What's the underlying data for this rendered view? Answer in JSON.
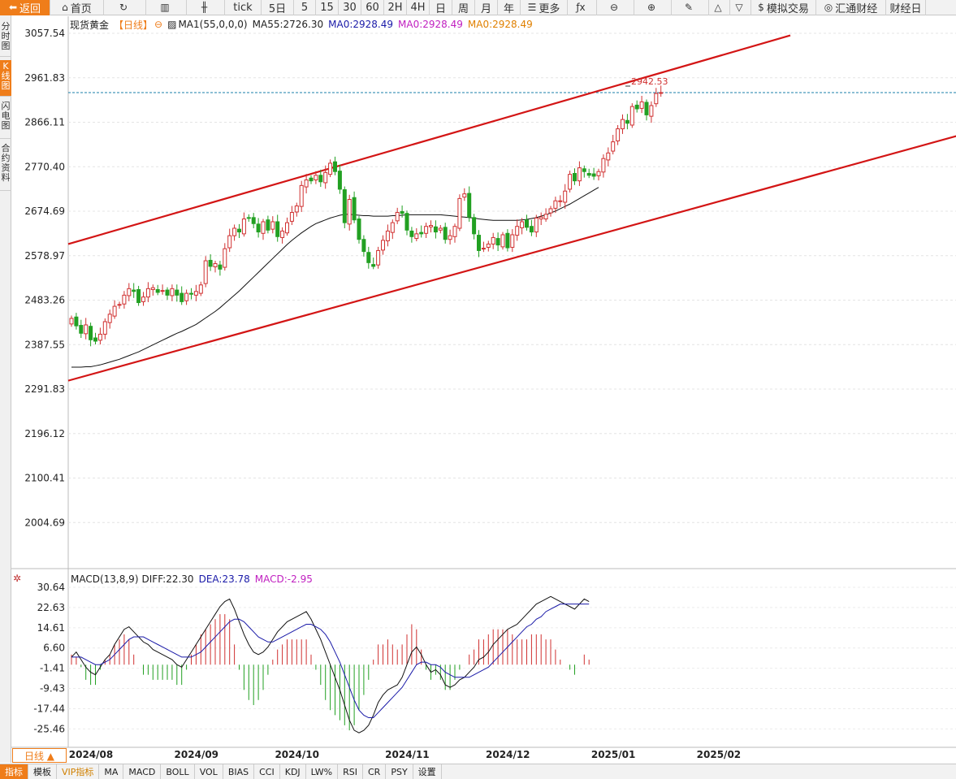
{
  "toolbar": {
    "items": [
      {
        "label": "返回",
        "icon": "back-arrow-icon",
        "glyph": "⬅",
        "w": 62
      },
      {
        "label": "首页",
        "icon": "home-icon",
        "glyph": "⌂",
        "w": 66
      },
      {
        "label": "",
        "icon": "refresh-icon",
        "glyph": "↻",
        "w": 52
      },
      {
        "label": "",
        "icon": "bar-chart-icon",
        "glyph": "▥",
        "w": 50
      },
      {
        "label": "",
        "icon": "candlestick-icon",
        "glyph": "╫",
        "w": 47
      },
      {
        "label": "tick",
        "icon": "",
        "glyph": "",
        "w": 45
      },
      {
        "label": "5日",
        "icon": "",
        "glyph": "",
        "w": 40
      },
      {
        "label": "5",
        "icon": "",
        "glyph": "",
        "w": 27
      },
      {
        "label": "15",
        "icon": "",
        "glyph": "",
        "w": 28
      },
      {
        "label": "30",
        "icon": "",
        "glyph": "",
        "w": 28
      },
      {
        "label": "60",
        "icon": "",
        "glyph": "",
        "w": 28
      },
      {
        "label": "2H",
        "icon": "",
        "glyph": "",
        "w": 28
      },
      {
        "label": "4H",
        "icon": "",
        "glyph": "",
        "w": 28
      },
      {
        "label": "日",
        "icon": "",
        "glyph": "",
        "w": 28
      },
      {
        "label": "周",
        "icon": "",
        "glyph": "",
        "w": 28
      },
      {
        "label": "月",
        "icon": "",
        "glyph": "",
        "w": 28
      },
      {
        "label": "年",
        "icon": "",
        "glyph": "",
        "w": 28
      },
      {
        "label": "更多",
        "icon": "menu-icon",
        "glyph": "☰",
        "w": 58
      },
      {
        "label": "",
        "icon": "formula-icon",
        "glyph": "ƒx",
        "w": 36
      },
      {
        "label": "",
        "icon": "zoom-out-icon",
        "glyph": "⊖",
        "w": 46
      },
      {
        "label": "",
        "icon": "zoom-in-icon",
        "glyph": "⊕",
        "w": 46
      },
      {
        "label": "",
        "icon": "pencil-icon",
        "glyph": "✎",
        "w": 46
      },
      {
        "label": "",
        "icon": "triangle-up-icon",
        "glyph": "△",
        "w": 26
      },
      {
        "label": "",
        "icon": "triangle-down-icon",
        "glyph": "▽",
        "w": 26
      },
      {
        "label": "模拟交易",
        "icon": "dollar-icon",
        "glyph": "$",
        "w": 80
      },
      {
        "label": "汇通财经",
        "icon": "logo-icon",
        "glyph": "◎",
        "w": 86
      },
      {
        "label": "财经日",
        "icon": "",
        "glyph": "",
        "w": 49
      }
    ]
  },
  "side_tabs": [
    {
      "label": "分时图",
      "active": false
    },
    {
      "label": "K线图",
      "active": true
    },
    {
      "label": "闪电图",
      "active": false
    },
    {
      "label": "合约资料",
      "active": false
    }
  ],
  "header": {
    "symbol": "现货黄金",
    "period": "【日线】",
    "ma1": "MA1(55,0,0,0)",
    "ma55": "MA55:2726.30",
    "ma0_a": "MA0:2928.49",
    "ma0_b": "MA0:2928.49",
    "ma0_c": "MA0:2928.49"
  },
  "macd_header": {
    "name": "MACD(13,8,9)",
    "diff": "DIFF:22.30",
    "dea": "DEA:23.78",
    "macd": "MACD:-2.95"
  },
  "date_tag": "日线 ▲",
  "bottom_tabs": [
    {
      "label": "指标",
      "active": true
    },
    {
      "label": "模板"
    },
    {
      "label": "VIP指标",
      "vip": true
    },
    {
      "label": "MA"
    },
    {
      "label": "MACD"
    },
    {
      "label": "BOLL"
    },
    {
      "label": "VOL"
    },
    {
      "label": "BIAS"
    },
    {
      "label": "CCI"
    },
    {
      "label": "KDJ"
    },
    {
      "label": "LW%"
    },
    {
      "label": "RSI"
    },
    {
      "label": "CR"
    },
    {
      "label": "PSY"
    },
    {
      "label": "设置"
    }
  ],
  "colors": {
    "up": "#d03030",
    "down": "#22a022",
    "trend": "#d31515",
    "ma": "#111111",
    "dea": "#1a1aa8",
    "ma0_purple": "#c020c0",
    "ma0_orange": "#e08000",
    "accent": "#ef7d1a"
  },
  "chart_data": [
    {
      "type": "candlestick",
      "title": "现货黄金 日线",
      "y_ticks": [
        3057.54,
        2961.83,
        2866.11,
        2770.4,
        2674.69,
        2578.97,
        2483.26,
        2387.55,
        2291.83,
        2196.12,
        2100.41,
        2004.69
      ],
      "ylim": [
        1960,
        3070
      ],
      "x_tick_labels": [
        "2024/08",
        "2024/09",
        "2024/10",
        "2024/11",
        "2024/12",
        "2025/01",
        "2025/02"
      ],
      "x_tick_index": [
        0,
        22,
        43,
        66,
        87,
        109,
        131
      ],
      "last_price_label": "2942.53",
      "last_price": 2930,
      "closes": [
        2444,
        2428,
        2412,
        2430,
        2398,
        2395,
        2410,
        2437,
        2453,
        2470,
        2474,
        2494,
        2508,
        2502,
        2478,
        2490,
        2508,
        2510,
        2500,
        2504,
        2494,
        2508,
        2494,
        2480,
        2498,
        2496,
        2502,
        2516,
        2568,
        2556,
        2562,
        2550,
        2594,
        2622,
        2638,
        2630,
        2658,
        2660,
        2648,
        2630,
        2652,
        2634,
        2652,
        2620,
        2632,
        2650,
        2672,
        2686,
        2730,
        2742,
        2740,
        2752,
        2738,
        2758,
        2778,
        2760,
        2722,
        2650,
        2700,
        2656,
        2614,
        2588,
        2564,
        2556,
        2590,
        2612,
        2632,
        2650,
        2672,
        2670,
        2634,
        2620,
        2626,
        2626,
        2642,
        2644,
        2630,
        2638,
        2614,
        2622,
        2642,
        2702,
        2712,
        2662,
        2626,
        2590,
        2595,
        2604,
        2618,
        2602,
        2624,
        2596,
        2624,
        2642,
        2652,
        2640,
        2630,
        2660,
        2662,
        2668,
        2680,
        2697,
        2697,
        2718,
        2754,
        2740,
        2768,
        2760,
        2752,
        2750,
        2760,
        2788,
        2800,
        2824,
        2852,
        2872,
        2864,
        2900,
        2895,
        2910,
        2882,
        2902,
        2928,
        2930
      ],
      "ma55": [
        2339,
        2339,
        2339,
        2340,
        2340,
        2342,
        2344,
        2347,
        2350,
        2353,
        2356,
        2360,
        2364,
        2368,
        2372,
        2377,
        2382,
        2387,
        2392,
        2397,
        2402,
        2407,
        2412,
        2416,
        2421,
        2426,
        2431,
        2438,
        2445,
        2452,
        2459,
        2467,
        2476,
        2485,
        2494,
        2503,
        2513,
        2523,
        2533,
        2543,
        2553,
        2563,
        2573,
        2583,
        2593,
        2603,
        2612,
        2620,
        2628,
        2635,
        2642,
        2648,
        2652,
        2656,
        2660,
        2663,
        2666,
        2668,
        2668,
        2667,
        2666,
        2665,
        2665,
        2664,
        2664,
        2664,
        2664,
        2665,
        2665,
        2666,
        2667,
        2667,
        2667,
        2667,
        2667,
        2667,
        2667,
        2667,
        2666,
        2665,
        2664,
        2663,
        2662,
        2661,
        2660,
        2658,
        2657,
        2656,
        2655,
        2655,
        2655,
        2655,
        2655,
        2655,
        2656,
        2657,
        2659,
        2661,
        2664,
        2667,
        2671,
        2675,
        2680,
        2685,
        2690,
        2696,
        2702,
        2708,
        2714,
        2720,
        2726
      ],
      "trendlines": [
        {
          "p1": [
            0,
            2604
          ],
          "p2": [
            150,
            3053
          ]
        },
        {
          "p1": [
            0,
            2310
          ],
          "p2": [
            200,
            2880
          ]
        }
      ]
    },
    {
      "type": "macd",
      "y_ticks": [
        30.64,
        22.63,
        14.61,
        6.6,
        -1.41,
        -9.43,
        -17.44,
        -25.46
      ],
      "ylim": [
        -33,
        33
      ],
      "diff": [
        3,
        5,
        2,
        -1,
        -3,
        -4,
        -1,
        2,
        4,
        8,
        11,
        14,
        15,
        13,
        11,
        9,
        8,
        6,
        5,
        4,
        3,
        2,
        0,
        -1,
        2,
        5,
        8,
        11,
        14,
        17,
        20,
        23,
        25,
        26,
        22,
        17,
        12,
        8,
        5,
        4,
        5,
        7,
        10,
        13,
        15,
        17,
        18,
        19,
        20,
        21,
        18,
        14,
        10,
        5,
        0,
        -5,
        -10,
        -16,
        -22,
        -26,
        -27,
        -26,
        -24,
        -20,
        -15,
        -12,
        -10,
        -9,
        -8,
        -5,
        0,
        5,
        7,
        4,
        0,
        -3,
        -2,
        -4,
        -8,
        -9,
        -8,
        -6,
        -5,
        -3,
        -1,
        2,
        3,
        5,
        8,
        10,
        12,
        14,
        15,
        16,
        18,
        20,
        22,
        24,
        25,
        26,
        27,
        26,
        25,
        24,
        23,
        22,
        24,
        26,
        25
      ],
      "dea": [
        3,
        3,
        3,
        2,
        1,
        0,
        0,
        1,
        2,
        4,
        6,
        8,
        10,
        11,
        11,
        11,
        10,
        9,
        8,
        7,
        6,
        5,
        4,
        3,
        3,
        3,
        4,
        5,
        7,
        9,
        11,
        13,
        15,
        17,
        18,
        18,
        17,
        15,
        13,
        11,
        10,
        9,
        9,
        10,
        11,
        12,
        13,
        14,
        15,
        16,
        16,
        15,
        14,
        12,
        9,
        5,
        1,
        -4,
        -9,
        -14,
        -18,
        -20,
        -21,
        -21,
        -19,
        -17,
        -15,
        -13,
        -11,
        -9,
        -6,
        -3,
        0,
        1,
        1,
        0,
        0,
        -1,
        -3,
        -4,
        -5,
        -5,
        -5,
        -5,
        -4,
        -3,
        -2,
        -1,
        1,
        3,
        5,
        7,
        9,
        11,
        13,
        15,
        16,
        18,
        19,
        21,
        22,
        23,
        24,
        24,
        24,
        24,
        24,
        24,
        24
      ],
      "hist": [
        4,
        3,
        -1,
        -6,
        -8,
        -8,
        -2,
        2,
        4,
        8,
        10,
        12,
        10,
        4,
        0,
        -4,
        -4,
        -6,
        -6,
        -6,
        -6,
        -6,
        -8,
        -8,
        -2,
        4,
        8,
        12,
        14,
        16,
        18,
        20,
        20,
        18,
        8,
        -2,
        -10,
        -14,
        -16,
        -14,
        -10,
        -4,
        2,
        6,
        8,
        10,
        10,
        10,
        10,
        10,
        4,
        -2,
        -8,
        -14,
        -18,
        -20,
        -22,
        -24,
        -26,
        -24,
        -18,
        -12,
        -6,
        2,
        8,
        8,
        10,
        8,
        6,
        8,
        12,
        16,
        14,
        6,
        -2,
        -6,
        -4,
        -6,
        -10,
        -10,
        -6,
        -2,
        0,
        4,
        6,
        10,
        10,
        12,
        14,
        14,
        14,
        14,
        12,
        10,
        10,
        10,
        12,
        12,
        12,
        10,
        10,
        6,
        2,
        0,
        -2,
        -4,
        0,
        4,
        2
      ]
    }
  ]
}
